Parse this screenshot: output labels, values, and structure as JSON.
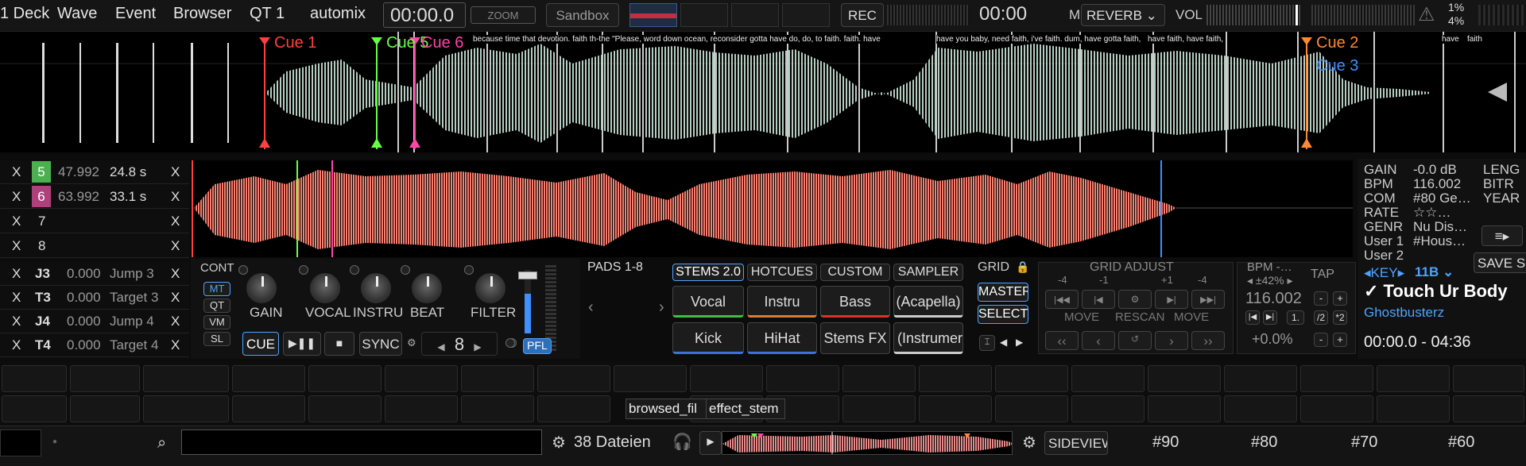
{
  "topbar": {
    "menus": [
      "1 Deck",
      "Wave",
      "Event",
      "Browser",
      "QT 1",
      "automix"
    ],
    "time": "00:00.0",
    "zoom": "ZOOM",
    "sandbox": "Sandbox",
    "rec": "REC",
    "rec_time": "00:00",
    "mfx": "M.FX",
    "fx_select": "REVERB",
    "vol": "VOL",
    "pct1": "1%",
    "pct2": "4%"
  },
  "cues": [
    {
      "label": "Cue 1",
      "color": "#ff4040"
    },
    {
      "label": "Cue 5",
      "color": "#66ff44"
    },
    {
      "label": "Cue 6",
      "color": "#ff44aa"
    },
    {
      "label": "Cue 2",
      "color": "#ff8833"
    },
    {
      "label": "Cue 3",
      "color": "#3f8fff"
    }
  ],
  "lyrics": [
    "because time that devotion. faith th-the \"Please, word down ocean, reconsider gotta have do, do, to faith. faith. have",
    "have you baby, need faith, i've faith. dum, have gotta faith,",
    "have faith, have faith,",
    "have",
    "faith"
  ],
  "cue_rows": [
    {
      "x": "X",
      "num": "5",
      "pos": "47.992",
      "len": "24.8 s",
      "x2": "X",
      "color": "#4caf50"
    },
    {
      "x": "X",
      "num": "6",
      "pos": "63.992",
      "len": "33.1 s",
      "x2": "X",
      "color": "#b0407c"
    },
    {
      "x": "X",
      "num": "7",
      "pos": "",
      "len": "",
      "x2": "X",
      "color": ""
    },
    {
      "x": "X",
      "num": "8",
      "pos": "",
      "len": "",
      "x2": "X",
      "color": ""
    }
  ],
  "jump_rows": [
    {
      "x": "X",
      "code": "J3",
      "val": "0.000",
      "name": "Jump 3",
      "x2": "X"
    },
    {
      "x": "X",
      "code": "T3",
      "val": "0.000",
      "name": "Target 3",
      "x2": "X"
    },
    {
      "x": "X",
      "code": "J4",
      "val": "0.000",
      "name": "Jump 4",
      "x2": "X"
    },
    {
      "x": "X",
      "code": "T4",
      "val": "0.000",
      "name": "Target 4",
      "x2": "X"
    }
  ],
  "mixer": {
    "cont": "CONT",
    "mt": "MT",
    "qt": "QT",
    "vm": "VM",
    "sl": "SL",
    "knobs": [
      "GAIN",
      "VOCAL",
      "INSTRU",
      "BEAT",
      "FILTER"
    ],
    "pfl": "PFL"
  },
  "transport": {
    "cue": "CUE",
    "play": "▶❚❚",
    "stop": "■",
    "sync": "SYNC",
    "loop": "8"
  },
  "pads": {
    "title": "PADS 1-8",
    "tabs": [
      "STEMS 2.0",
      "HOTCUES",
      "CUSTOM",
      "SAMPLER"
    ],
    "buttons": [
      {
        "label": "Vocal",
        "line": "#3fbf3f"
      },
      {
        "label": "Instru",
        "line": "#e07b2a"
      },
      {
        "label": "Bass",
        "line": "#e03030"
      },
      {
        "label": "(Acapella)",
        "line": "#cccccc"
      },
      {
        "label": "Kick",
        "line": "#4070e0"
      },
      {
        "label": "HiHat",
        "line": "#4070e0"
      },
      {
        "label": "Stems FX",
        "line": ""
      },
      {
        "label": "(Instrumer",
        "line": "#cccccc"
      }
    ]
  },
  "grid": {
    "title": "GRID",
    "master": "MASTER",
    "select": "SELECT",
    "adjust": "GRID ADJUST",
    "steps": [
      "-4",
      "-1",
      "+1",
      "-4"
    ],
    "move": "MOVE",
    "rescan": "RESCAN",
    "move2": "MOVE"
  },
  "bpm": {
    "title": "BPM -…",
    "range": "◂ ±42% ▸",
    "value": "116.002",
    "pitch": "+0.0%",
    "tap": "TAP",
    "half": "/2",
    "dbl": "*2",
    "one": "1."
  },
  "track": {
    "gain_k": "GAIN",
    "gain_v": "-0.0 dB",
    "bpm_k": "BPM",
    "bpm_v": "116.002",
    "com_k": "COM",
    "com_v": "#80 Ge…",
    "rate_k": "RATE",
    "rate_v": "☆☆…",
    "genre_k": "GENR",
    "genre_v": "Nu Dis…",
    "user1_k": "User 1",
    "user1_v": "#Hous…",
    "user2_k": "User 2",
    "len_k": "LENG",
    "bitr_k": "BITR",
    "year_k": "YEAR",
    "key_k": "KEY",
    "key_v": "11B",
    "save": "SAVE S",
    "title": "✓ Touch Ur Body",
    "artist": "Ghostbusterz",
    "range": "00:00.0 - 04:36"
  },
  "browser": {
    "tooltip1": "browsed_fil",
    "tooltip2": "effect_stem",
    "files": "38 Dateien",
    "sideview": "SIDEVIEW",
    "cols": [
      "#90",
      "#80",
      "#70",
      "#60"
    ]
  }
}
